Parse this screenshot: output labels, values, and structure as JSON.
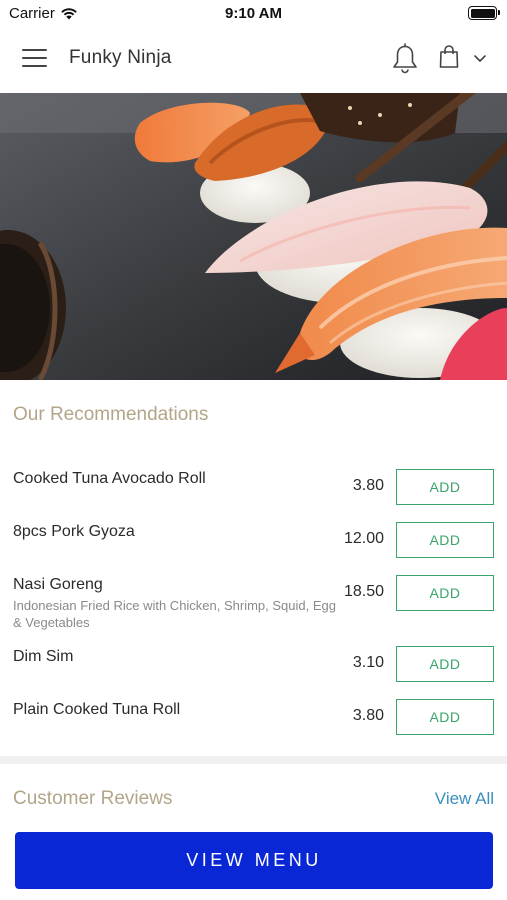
{
  "status_bar": {
    "carrier": "Carrier",
    "time": "9:10 AM"
  },
  "header": {
    "title": "Funky Ninja",
    "icons": [
      "menu-icon",
      "bell-icon",
      "shopping-bag-icon",
      "chevron-down-icon"
    ]
  },
  "hero": {
    "image": "sushi-photo"
  },
  "recommendations": {
    "title": "Our Recommendations",
    "items": [
      {
        "name": "Cooked Tuna Avocado Roll",
        "description": "",
        "price": "3.80",
        "add_label": "ADD"
      },
      {
        "name": "8pcs Pork Gyoza",
        "description": "",
        "price": "12.00",
        "add_label": "ADD"
      },
      {
        "name": "Nasi Goreng",
        "description": "Indonesian Fried Rice with Chicken, Shrimp, Squid, Egg & Vegetables",
        "price": "18.50",
        "add_label": "ADD"
      },
      {
        "name": "Dim Sim",
        "description": "",
        "price": "3.10",
        "add_label": "ADD"
      },
      {
        "name": "Plain Cooked Tuna Roll",
        "description": "",
        "price": "3.80",
        "add_label": "ADD"
      }
    ]
  },
  "reviews": {
    "title": "Customer Reviews",
    "view_all_label": "View All"
  },
  "footer": {
    "view_menu_label": "VIEW MENU"
  },
  "colors": {
    "accent_gold": "#b3a58a",
    "add_green": "#3aa56a",
    "link_blue": "#3a8fbf",
    "primary_button": "#0a27d6"
  }
}
